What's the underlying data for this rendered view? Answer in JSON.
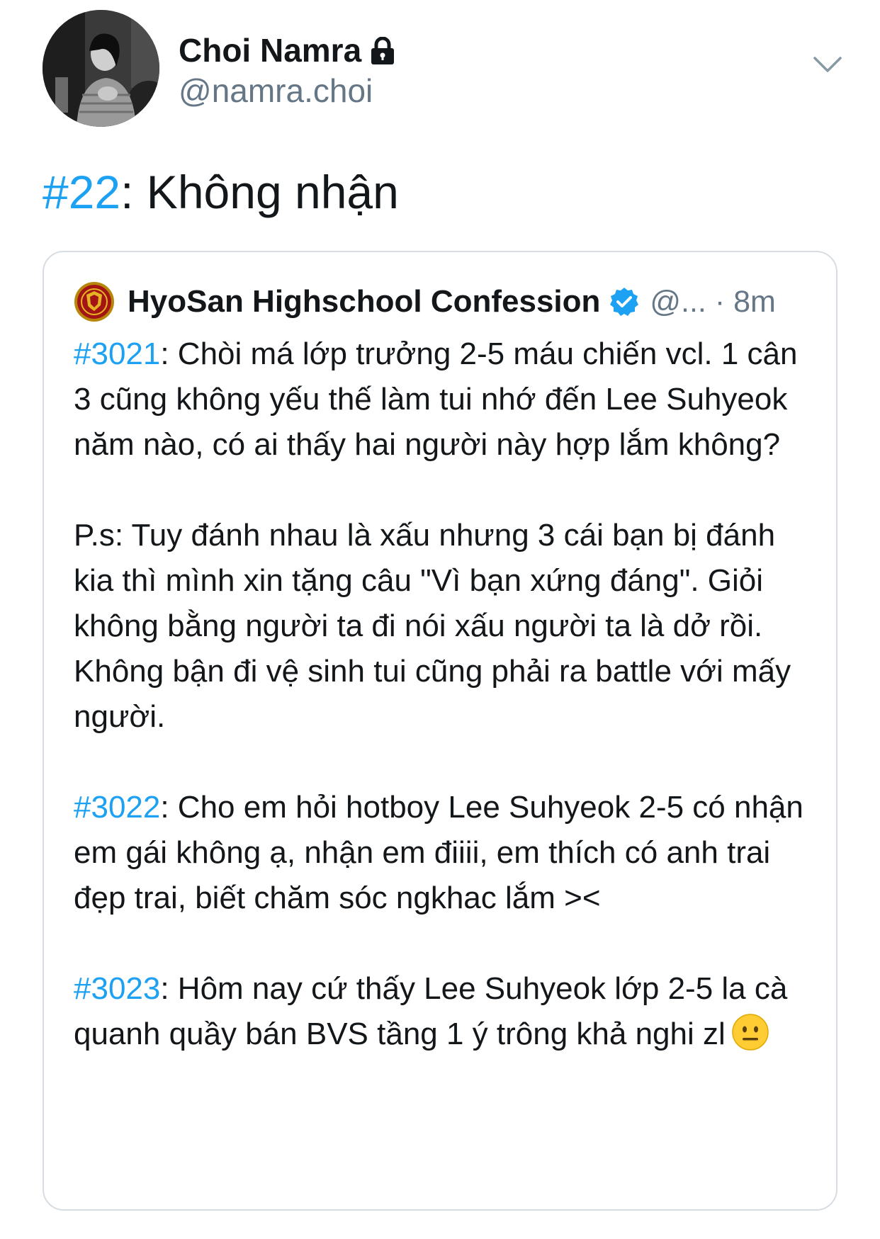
{
  "author": {
    "name": "Choi Namra",
    "handle": "@namra.choi",
    "protected_icon": "lock-icon",
    "avatar_icon": "profile-photo"
  },
  "header_menu_icon": "chevron-down-icon",
  "tweet": {
    "hashtag": "#22",
    "text": ": Không nhận"
  },
  "quoted": {
    "name": "HyoSan Highschool Confession",
    "handle_time": "@... · 8m",
    "verified_icon": "verified-badge-icon",
    "logo_icon": "school-crest-icon",
    "paragraphs": [
      {
        "hashtag": "#3021",
        "text": ": Chòi má lớp trưởng 2-5 máu chiến vcl. 1 cân 3 cũng không yếu thế làm tui nhớ đến Lee Suhyeok năm nào, có ai thấy hai người này hợp lắm không?"
      },
      {
        "hashtag": "",
        "text": "P.s: Tuy đánh nhau là xấu nhưng 3 cái bạn bị đánh kia thì mình xin tặng câu \"Vì bạn xứng đáng\". Giỏi không bằng người ta đi nói xấu người ta là dở rồi. Không bận đi vệ sinh tui cũng phải ra battle với mấy người."
      },
      {
        "hashtag": "#3022",
        "text": ":  Cho em hỏi hotboy Lee Suhyeok 2-5 có nhận em gái không ạ, nhận em điiii, em thích có anh trai đẹp trai, biết chăm sóc ngkhac lắm ><"
      },
      {
        "hashtag": "#3023",
        "text": ": Hôm nay cứ thấy Lee Suhyeok lớp 2-5 la cà quanh quầy bán BVS tầng 1 ý trông khả nghi zl"
      }
    ],
    "final_emoji_icon": "neutral-face-emoji"
  },
  "colors": {
    "link": "#1da1f2",
    "secondary_text": "#657786",
    "border": "#d7dde2",
    "verified": "#1da1f2"
  }
}
